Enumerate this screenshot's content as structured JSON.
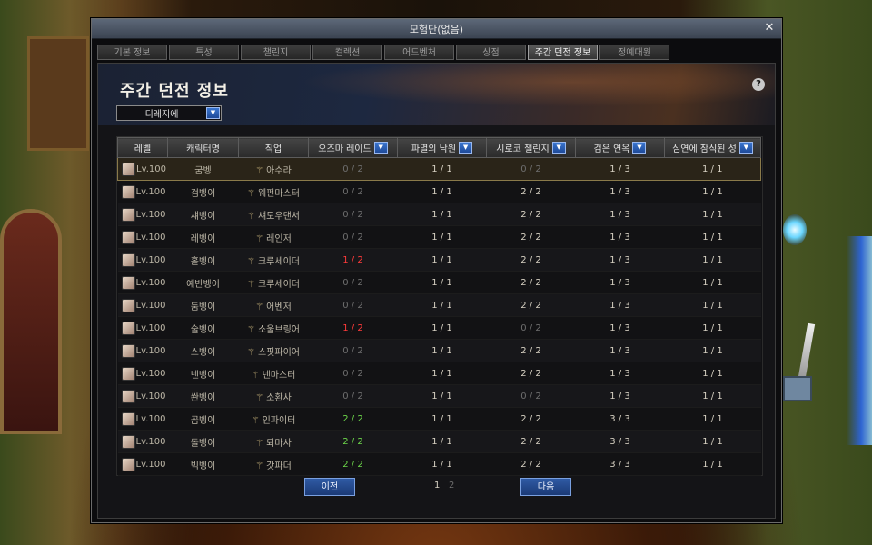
{
  "window": {
    "title": "모험단(없음)",
    "close": "✕"
  },
  "tabs": [
    {
      "label": "기본 정보",
      "active": false
    },
    {
      "label": "특성",
      "active": false
    },
    {
      "label": "챌린지",
      "active": false
    },
    {
      "label": "컬렉션",
      "active": false
    },
    {
      "label": "어드벤처",
      "active": false
    },
    {
      "label": "상점",
      "active": false
    },
    {
      "label": "주간 던전 정보",
      "active": true
    },
    {
      "label": "정예대원",
      "active": false
    }
  ],
  "page": {
    "title": "주간 던전 정보",
    "dropdown_value": "디레지에",
    "help": "?"
  },
  "table": {
    "columns": [
      "레벨",
      "캐릭터명",
      "직업",
      "오즈마 레이드",
      "파멸의 낙원",
      "시로코 챌린지",
      "검은 연옥",
      "심연에 잠식된 성"
    ],
    "rows": [
      {
        "level": "Lv.100",
        "name": "굼벵",
        "job": "아수라",
        "c1": "0 / 2",
        "c2": "1 / 1",
        "c3": "0 / 2",
        "c4": "1 / 3",
        "c5": "1 / 1",
        "selected": true
      },
      {
        "level": "Lv.100",
        "name": "검벵이",
        "job": "웨펀마스터",
        "c1": "0 / 2",
        "c2": "1 / 1",
        "c3": "2 / 2",
        "c4": "1 / 3",
        "c5": "1 / 1"
      },
      {
        "level": "Lv.100",
        "name": "섀벵이",
        "job": "섀도우댄서",
        "c1": "0 / 2",
        "c2": "1 / 1",
        "c3": "2 / 2",
        "c4": "1 / 3",
        "c5": "1 / 1"
      },
      {
        "level": "Lv.100",
        "name": "레벵이",
        "job": "레인저",
        "c1": "0 / 2",
        "c2": "1 / 1",
        "c3": "2 / 2",
        "c4": "1 / 3",
        "c5": "1 / 1"
      },
      {
        "level": "Lv.100",
        "name": "홀벵이",
        "job": "크루세이더",
        "c1": "1 / 2",
        "c2": "1 / 1",
        "c3": "2 / 2",
        "c4": "1 / 3",
        "c5": "1 / 1"
      },
      {
        "level": "Lv.100",
        "name": "예반벵이",
        "job": "크루세이더",
        "c1": "0 / 2",
        "c2": "1 / 1",
        "c3": "2 / 2",
        "c4": "1 / 3",
        "c5": "1 / 1"
      },
      {
        "level": "Lv.100",
        "name": "둠벵이",
        "job": "어벤저",
        "c1": "0 / 2",
        "c2": "1 / 1",
        "c3": "2 / 2",
        "c4": "1 / 3",
        "c5": "1 / 1"
      },
      {
        "level": "Lv.100",
        "name": "술벵이",
        "job": "소울브링어",
        "c1": "1 / 2",
        "c2": "1 / 1",
        "c3": "0 / 2",
        "c4": "1 / 3",
        "c5": "1 / 1"
      },
      {
        "level": "Lv.100",
        "name": "스벵이",
        "job": "스핏파이어",
        "c1": "0 / 2",
        "c2": "1 / 1",
        "c3": "2 / 2",
        "c4": "1 / 3",
        "c5": "1 / 1"
      },
      {
        "level": "Lv.100",
        "name": "넨벵이",
        "job": "넨마스터",
        "c1": "0 / 2",
        "c2": "1 / 1",
        "c3": "2 / 2",
        "c4": "1 / 3",
        "c5": "1 / 1"
      },
      {
        "level": "Lv.100",
        "name": "쏸벵이",
        "job": "소환사",
        "c1": "0 / 2",
        "c2": "1 / 1",
        "c3": "0 / 2",
        "c4": "1 / 3",
        "c5": "1 / 1"
      },
      {
        "level": "Lv.100",
        "name": "곰벵이",
        "job": "인파이터",
        "c1": "2 / 2",
        "c2": "1 / 1",
        "c3": "2 / 2",
        "c4": "3 / 3",
        "c5": "1 / 1"
      },
      {
        "level": "Lv.100",
        "name": "돌벵이",
        "job": "퇴마사",
        "c1": "2 / 2",
        "c2": "1 / 1",
        "c3": "2 / 2",
        "c4": "3 / 3",
        "c5": "1 / 1"
      },
      {
        "level": "Lv.100",
        "name": "빅벵이",
        "job": "갓파더",
        "c1": "2 / 2",
        "c2": "1 / 1",
        "c3": "2 / 2",
        "c4": "3 / 3",
        "c5": "1 / 1"
      }
    ]
  },
  "pager": {
    "prev": "이전",
    "next": "다음",
    "pages": [
      "1",
      "2"
    ],
    "current": "1"
  },
  "colors": {
    "red": "#ff3a3a",
    "green": "#6cd64a",
    "gray": "#6e6e6e",
    "accent": "#2f5aa4"
  }
}
